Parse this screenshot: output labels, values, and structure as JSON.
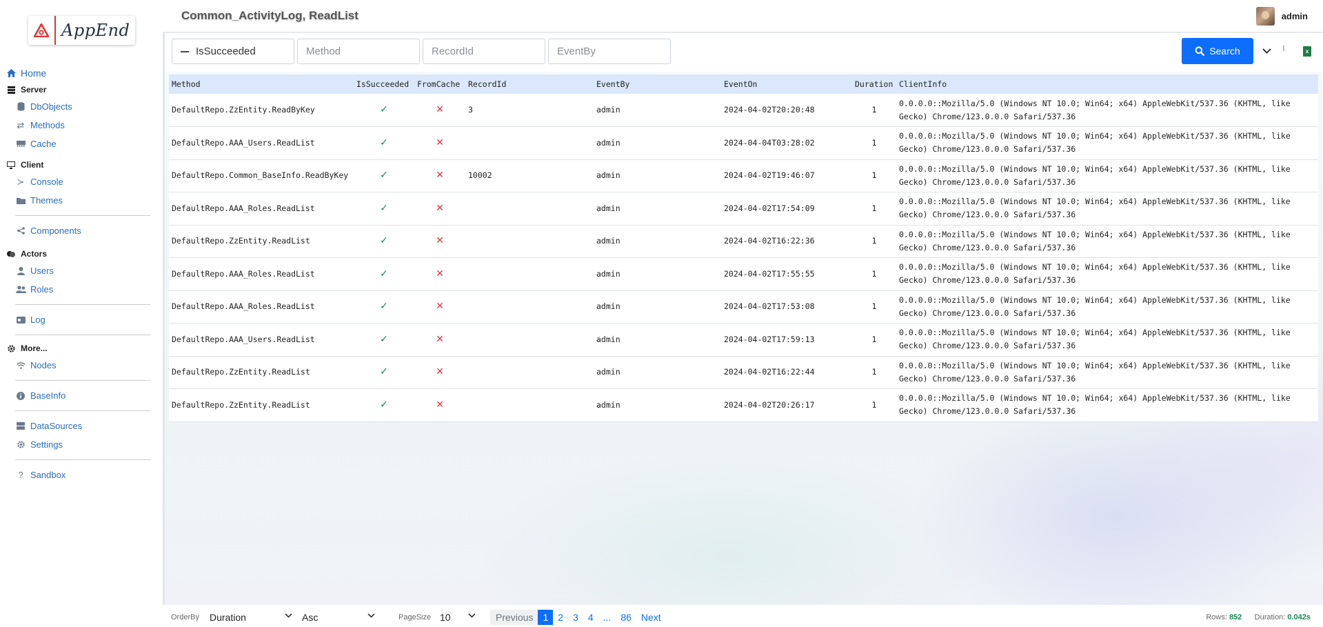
{
  "app": {
    "logo_text": "AppEnd",
    "page_title": "Common_ActivityLog, ReadList"
  },
  "user": {
    "name": "admin"
  },
  "sidebar": {
    "home": "Home",
    "server": {
      "label": "Server",
      "items": [
        "DbObjects",
        "Methods",
        "Cache"
      ]
    },
    "client": {
      "label": "Client",
      "items": [
        "Console",
        "Themes"
      ]
    },
    "components": "Components",
    "actors": {
      "label": "Actors",
      "items": [
        "Users",
        "Roles"
      ]
    },
    "log": "Log",
    "more": {
      "label": "More...",
      "items": [
        "Nodes"
      ]
    },
    "baseinfo": "BaseInfo",
    "datasources": "DataSources",
    "settings": "Settings",
    "sandbox": "Sandbox"
  },
  "filters": {
    "issucceeded_placeholder": "IsSucceeded",
    "method_placeholder": "Method",
    "recordid_placeholder": "RecordId",
    "eventby_placeholder": "EventBy",
    "search_label": "Search"
  },
  "table": {
    "columns": [
      "Method",
      "IsSucceeded",
      "FromCache",
      "RecordId",
      "EventBy",
      "EventOn",
      "Duration",
      "ClientInfo"
    ],
    "rows": [
      {
        "method": "DefaultRepo.ZzEntity.ReadByKey",
        "succeeded": "✓",
        "from_cache": "✕",
        "record_id": "3",
        "event_by": "admin",
        "event_on": "2024-04-02T20:20:48",
        "duration": "1",
        "client_info": "0.0.0.0::Mozilla/5.0 (Windows NT 10.0; Win64; x64) AppleWebKit/537.36 (KHTML, like Gecko) Chrome/123.0.0.0 Safari/537.36"
      },
      {
        "method": "DefaultRepo.AAA_Users.ReadList",
        "succeeded": "✓",
        "from_cache": "✕",
        "record_id": "",
        "event_by": "admin",
        "event_on": "2024-04-04T03:28:02",
        "duration": "1",
        "client_info": "0.0.0.0::Mozilla/5.0 (Windows NT 10.0; Win64; x64) AppleWebKit/537.36 (KHTML, like Gecko) Chrome/123.0.0.0 Safari/537.36"
      },
      {
        "method": "DefaultRepo.Common_BaseInfo.ReadByKey",
        "succeeded": "✓",
        "from_cache": "✕",
        "record_id": "10002",
        "event_by": "admin",
        "event_on": "2024-04-02T19:46:07",
        "duration": "1",
        "client_info": "0.0.0.0::Mozilla/5.0 (Windows NT 10.0; Win64; x64) AppleWebKit/537.36 (KHTML, like Gecko) Chrome/123.0.0.0 Safari/537.36"
      },
      {
        "method": "DefaultRepo.AAA_Roles.ReadList",
        "succeeded": "✓",
        "from_cache": "✕",
        "record_id": "",
        "event_by": "admin",
        "event_on": "2024-04-02T17:54:09",
        "duration": "1",
        "client_info": "0.0.0.0::Mozilla/5.0 (Windows NT 10.0; Win64; x64) AppleWebKit/537.36 (KHTML, like Gecko) Chrome/123.0.0.0 Safari/537.36"
      },
      {
        "method": "DefaultRepo.ZzEntity.ReadList",
        "succeeded": "✓",
        "from_cache": "✕",
        "record_id": "",
        "event_by": "admin",
        "event_on": "2024-04-02T16:22:36",
        "duration": "1",
        "client_info": "0.0.0.0::Mozilla/5.0 (Windows NT 10.0; Win64; x64) AppleWebKit/537.36 (KHTML, like Gecko) Chrome/123.0.0.0 Safari/537.36"
      },
      {
        "method": "DefaultRepo.AAA_Roles.ReadList",
        "succeeded": "✓",
        "from_cache": "✕",
        "record_id": "",
        "event_by": "admin",
        "event_on": "2024-04-02T17:55:55",
        "duration": "1",
        "client_info": "0.0.0.0::Mozilla/5.0 (Windows NT 10.0; Win64; x64) AppleWebKit/537.36 (KHTML, like Gecko) Chrome/123.0.0.0 Safari/537.36"
      },
      {
        "method": "DefaultRepo.AAA_Roles.ReadList",
        "succeeded": "✓",
        "from_cache": "✕",
        "record_id": "",
        "event_by": "admin",
        "event_on": "2024-04-02T17:53:08",
        "duration": "1",
        "client_info": "0.0.0.0::Mozilla/5.0 (Windows NT 10.0; Win64; x64) AppleWebKit/537.36 (KHTML, like Gecko) Chrome/123.0.0.0 Safari/537.36"
      },
      {
        "method": "DefaultRepo.AAA_Users.ReadList",
        "succeeded": "✓",
        "from_cache": "✕",
        "record_id": "",
        "event_by": "admin",
        "event_on": "2024-04-02T17:59:13",
        "duration": "1",
        "client_info": "0.0.0.0::Mozilla/5.0 (Windows NT 10.0; Win64; x64) AppleWebKit/537.36 (KHTML, like Gecko) Chrome/123.0.0.0 Safari/537.36"
      },
      {
        "method": "DefaultRepo.ZzEntity.ReadList",
        "succeeded": "✓",
        "from_cache": "✕",
        "record_id": "",
        "event_by": "admin",
        "event_on": "2024-04-02T16:22:44",
        "duration": "1",
        "client_info": "0.0.0.0::Mozilla/5.0 (Windows NT 10.0; Win64; x64) AppleWebKit/537.36 (KHTML, like Gecko) Chrome/123.0.0.0 Safari/537.36"
      },
      {
        "method": "DefaultRepo.ZzEntity.ReadList",
        "succeeded": "✓",
        "from_cache": "✕",
        "record_id": "",
        "event_by": "admin",
        "event_on": "2024-04-02T20:26:17",
        "duration": "1",
        "client_info": "0.0.0.0::Mozilla/5.0 (Windows NT 10.0; Win64; x64) AppleWebKit/537.36 (KHTML, like Gecko) Chrome/123.0.0.0 Safari/537.36"
      }
    ]
  },
  "footer": {
    "orderby_label": "OrderBy",
    "orderby_value": "Duration",
    "direction_value": "Asc",
    "pagesize_label": "PageSize",
    "pagesize_value": "10",
    "pager": {
      "previous": "Previous",
      "pages": [
        "1",
        "2",
        "3",
        "4"
      ],
      "ellipsis": "...",
      "last": "86",
      "next": "Next"
    },
    "rows_label": "Rows:",
    "rows_value": "852",
    "duration_label": "Duration:",
    "duration_value": "0.042s"
  },
  "colors": {
    "accent": "#0d6efd",
    "success": "#198754",
    "danger": "#dc3545",
    "header_row": "#dbe8fb"
  }
}
